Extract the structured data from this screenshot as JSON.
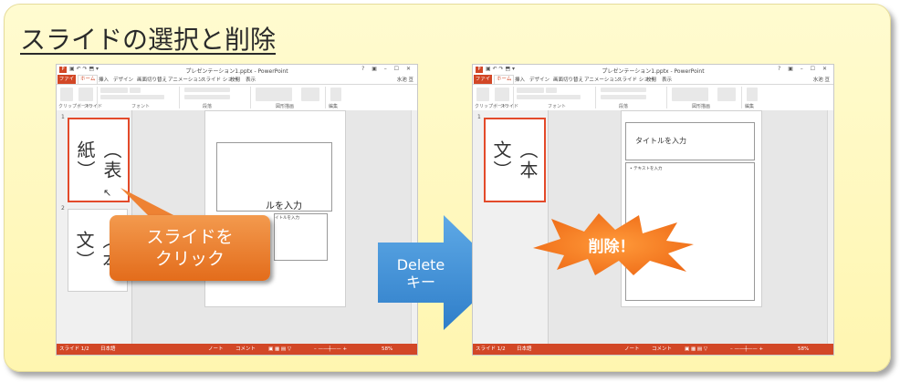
{
  "title": "スライドの選択と削除",
  "window": {
    "app_icon": "P",
    "doc_title": "プレゼンテーション1.pptx - PowerPoint",
    "window_controls": "? ▣ – ☐ ✕",
    "tabs": [
      "ファイル",
      "ホーム",
      "挿入",
      "デザイン",
      "画面切り替え",
      "アニメーション",
      "スライド ショー",
      "校閲",
      "表示"
    ],
    "user": "水池 亘",
    "ribbon_groups": [
      "クリップボード",
      "スライド",
      "フォント",
      "段落",
      "図形描画",
      "編集"
    ],
    "status_left": "スライド 1/2",
    "status_lang": "日本語",
    "status_notes": "ノート",
    "status_comments": "コメント",
    "zoom": "58%"
  },
  "left": {
    "thumbs": [
      {
        "num": "1",
        "text": "（表紙）"
      },
      {
        "num": "2",
        "text": "（本文）"
      }
    ],
    "slide_title_fragment": "ルを入力",
    "slide_body_fragment": "イトルを入力",
    "callout": "スライドを\nクリック"
  },
  "arrow_label": "Delete\nキー",
  "right": {
    "thumbs": [
      {
        "num": "1",
        "text": "（本文）"
      }
    ],
    "slide_title": "タイトルを入力",
    "slide_body": "• テキストを入力",
    "burst": "削除！"
  },
  "colors": {
    "accent": "#d24726",
    "callout": "#e9782a",
    "arrow": "#3b8fd6",
    "burst": "#f07a22"
  }
}
